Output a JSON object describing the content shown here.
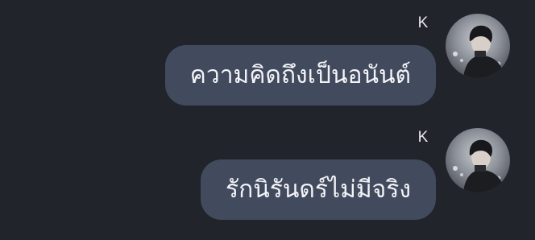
{
  "messages": [
    {
      "sender": "K",
      "text": "ความคิดถึงเป็นอนันต์",
      "avatar_icon": "profile-photo-icon"
    },
    {
      "sender": "K",
      "text": "รักนิรันดร์ไม่มีจริง",
      "avatar_icon": "profile-photo-icon"
    }
  ],
  "colors": {
    "background": "#22242b",
    "bubble": "#424a5d",
    "text": "#f3f4f8"
  }
}
